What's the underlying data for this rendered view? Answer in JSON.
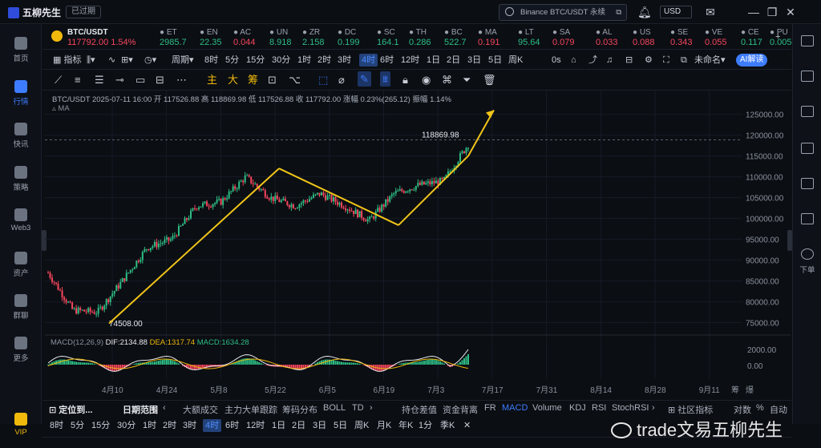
{
  "titlebar": {
    "app_name": "五柳先生",
    "expired_badge": "已过期",
    "search_text": "Binance BTC/USDT 永续",
    "currency": "USD"
  },
  "sidebar": {
    "items": [
      {
        "label": "首页",
        "icon": "home-icon"
      },
      {
        "label": "行情",
        "icon": "bar-chart-icon",
        "active": true
      },
      {
        "label": "快讯",
        "icon": "news-icon"
      },
      {
        "label": "策略",
        "icon": "robot-icon"
      },
      {
        "label": "Web3",
        "icon": "web3-icon"
      },
      {
        "label": "资产",
        "icon": "wallet-icon"
      },
      {
        "label": "群聊",
        "icon": "chat-icon"
      },
      {
        "label": "更多",
        "icon": "apps-icon"
      },
      {
        "label": "VIP",
        "icon": "crown-icon"
      }
    ]
  },
  "rightbar": {
    "download_label": "下单"
  },
  "tickers": [
    {
      "symbol": "BTC/USDT",
      "price": "117792.00",
      "change": "1.54%",
      "dir": "up"
    },
    {
      "symbol": "ET",
      "price": "2985.7",
      "dir": "up"
    },
    {
      "symbol": "EN",
      "price": "22.35",
      "dir": "up"
    },
    {
      "symbol": "AC",
      "price": "0.044",
      "dir": "dn"
    },
    {
      "symbol": "UN",
      "price": "8.918",
      "dir": "up"
    },
    {
      "symbol": "ZR",
      "price": "2.158",
      "dir": "up"
    },
    {
      "symbol": "DC",
      "price": "0.199",
      "dir": "up"
    },
    {
      "symbol": "SC",
      "price": "164.1",
      "dir": "up"
    },
    {
      "symbol": "TH",
      "price": "0.286",
      "dir": "up"
    },
    {
      "symbol": "BC",
      "price": "522.7",
      "dir": "up"
    },
    {
      "symbol": "MA",
      "price": "0.191",
      "dir": "dn"
    },
    {
      "symbol": "LT",
      "price": "95.64",
      "dir": "up"
    },
    {
      "symbol": "SA",
      "price": "0.079",
      "dir": "dn"
    },
    {
      "symbol": "AL",
      "price": "0.033",
      "dir": "dn"
    },
    {
      "symbol": "US",
      "price": "0.088",
      "dir": "dn"
    },
    {
      "symbol": "SE",
      "price": "0.343",
      "dir": "dn"
    },
    {
      "symbol": "VE",
      "price": "0.055",
      "dir": "dn"
    },
    {
      "symbol": "CE",
      "price": "0.117",
      "dir": "up"
    },
    {
      "symbol": "PU",
      "price": "0.005",
      "dir": "up"
    }
  ],
  "toolbar": {
    "indicators": "指标",
    "period": "周期",
    "timeframes": [
      "8时",
      "5分",
      "15分",
      "30分",
      "1时",
      "2时",
      "3时",
      "4时",
      "6时",
      "12时",
      "1日",
      "2日",
      "3日",
      "5日",
      "周K"
    ],
    "selected_timeframe": "4时",
    "countdown": "0s",
    "unnamed": "未命名",
    "ai": "AI解读"
  },
  "drawtools": {
    "labels": [
      "主",
      "大",
      "筹"
    ]
  },
  "chart": {
    "info": "BTC/USDT  2025-07-11 16:00  开 117526.88  高 118869.98  低 117526.88  收 117792.00  涨幅 0.23%(265.12)  振幅 1.14%",
    "ma_label": "MA",
    "high_label": "118869.98",
    "low_label": "74508.00",
    "macd_name": "MACD(12,26,9)",
    "dif": "DIF:2134.88",
    "dea": "DEA:1317.74",
    "macd": "MACD:1634.28",
    "macd_ticks": [
      "2000.00",
      "0.00"
    ],
    "x_ticks": [
      "4月10",
      "4月24",
      "5月8",
      "5月22",
      "6月5",
      "6月19",
      "7月3",
      "7月17",
      "7月31",
      "8月14",
      "8月28",
      "9月11"
    ],
    "corner_labels": [
      "筹",
      "爆"
    ]
  },
  "chart_data": {
    "type": "line",
    "title": "BTC/USDT",
    "y_ticks": [
      75000,
      80000,
      85000,
      90000,
      95000,
      100000,
      105000,
      110000,
      115000,
      120000,
      125000
    ],
    "ylim": [
      73000,
      128000
    ],
    "series": [
      {
        "name": "",
        "x": [
          "4月3",
          "4月7",
          "4月10",
          "4月17",
          "4月24",
          "5月1",
          "5月8",
          "5月15",
          "5月22",
          "5月29",
          "6月5",
          "6月12",
          "6月19",
          "6月22",
          "6月26",
          "7月3",
          "7月7",
          "7月11"
        ],
        "values": [
          87000,
          78000,
          77500,
          85000,
          93000,
          95000,
          103000,
          104000,
          110000,
          105000,
          103000,
          106000,
          103000,
          99500,
          106000,
          108000,
          109000,
          117800
        ]
      }
    ]
  },
  "bottom": {
    "locate": "定位到...",
    "date_range": "日期范围",
    "tools": [
      "大额成交",
      "主力大单跟踪",
      "筹码分布",
      "BOLL",
      "TD"
    ],
    "tools2": [
      "持仓差值",
      "资金背离",
      "FR",
      "MACD",
      "Volume",
      "KDJ",
      "RSI",
      "StochRSI"
    ],
    "community": "社区指标",
    "log": "对数",
    "pct": "%",
    "auto": "自动",
    "row2": [
      "8时",
      "5分",
      "15分",
      "30分",
      "1时",
      "2时",
      "3时",
      "4时",
      "6时",
      "12时",
      "1日",
      "2日",
      "3日",
      "5日",
      "周K",
      "月K",
      "年K",
      "1分",
      "季K"
    ],
    "row2_selected": "4时"
  },
  "watermark": "trade文易五柳先生"
}
